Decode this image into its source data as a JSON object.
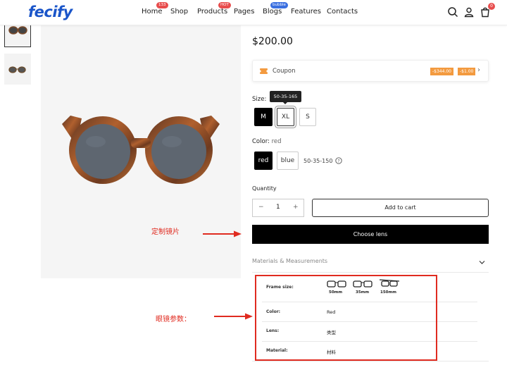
{
  "header": {
    "logo": "fecify",
    "nav": [
      {
        "label": "Home",
        "badge": "133",
        "badge_color": "#e84d4d"
      },
      {
        "label": "Shop",
        "badge": "",
        "badge_color": ""
      },
      {
        "label": "Products",
        "badge": "HOT",
        "badge_color": "#e84d4d"
      },
      {
        "label": "Pages",
        "badge": "",
        "badge_color": ""
      },
      {
        "label": "Blogs",
        "badge": "bubble",
        "badge_color": "#3a6fe0"
      },
      {
        "label": "Features",
        "badge": "",
        "badge_color": ""
      },
      {
        "label": "Contacts",
        "badge": "",
        "badge_color": ""
      }
    ],
    "icons": [
      "search-icon",
      "user-icon",
      "cart-icon"
    ],
    "cart_count": "0"
  },
  "product": {
    "price": "$200.00",
    "coupon": {
      "label": "Coupon",
      "tags": [
        "-$344.00",
        "-$1.00"
      ]
    },
    "size": {
      "label": "Size:",
      "tooltip": "50-35-165",
      "options": [
        "M",
        "XL",
        "S"
      ],
      "selected": "M"
    },
    "color": {
      "label": "Color:",
      "value": "red",
      "options": [
        "red",
        "blue"
      ],
      "selected": "red",
      "measure": "50-35-150"
    },
    "quantity": {
      "label": "Quantity",
      "value": "1",
      "minus": "−",
      "plus": "+"
    },
    "add_to_cart": "Add to cart",
    "choose_lens": "Choose lens",
    "materials_heading": "Materials & Measurements"
  },
  "specs": {
    "frame_size_label": "Frame size:",
    "frame_sizes": [
      "50mm",
      "35mm",
      "150mm"
    ],
    "color_label": "Color:",
    "color_value": "Red",
    "lens_label": "Lens:",
    "lens_value": "类型",
    "material_label": "Material:",
    "material_value": "材料"
  },
  "annotations": {
    "lens_note": "定制镜片",
    "params_note": "眼镜参数："
  },
  "colors": {
    "brand": "#1a55c9",
    "accent": "#e84d4d",
    "coupon_tag": "#f39a3f",
    "annotation": "#e02b20"
  }
}
